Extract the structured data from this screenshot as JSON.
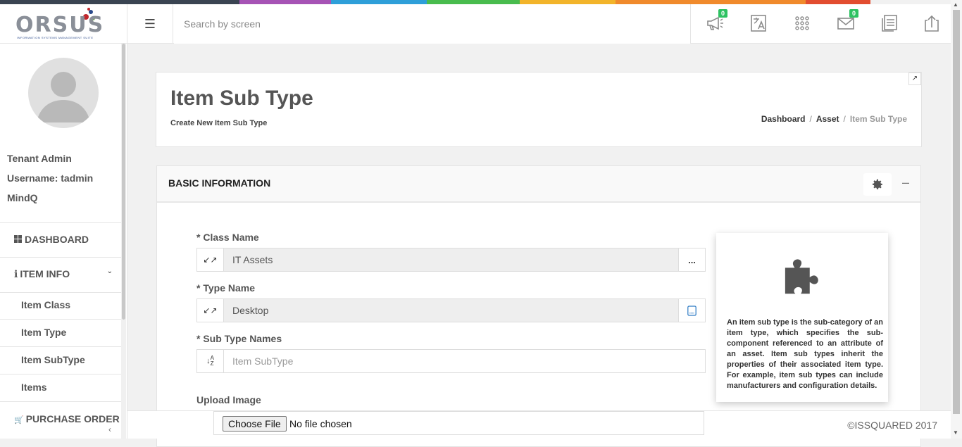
{
  "top_stripe_colors": [
    "#3a4452",
    "#3a4452",
    "#a653b5",
    "#2e9fd9",
    "#49bc4e",
    "#f2b42a",
    "#f08a2c",
    "#e24d30"
  ],
  "header": {
    "logo_text": "ORSUS",
    "logo_subtitle": "INFORMATION SYSTEMS MANAGEMENT SUITE",
    "search_placeholder": "Search by screen",
    "notifications_badge": "0",
    "messages_badge": "0"
  },
  "sidebar": {
    "user_role": "Tenant Admin",
    "username": "Username: tadmin",
    "org": "MindQ",
    "nav": {
      "dashboard": "DASHBOARD",
      "item_info": "ITEM INFO",
      "item_class": "Item Class",
      "item_type": "Item Type",
      "item_subtype": "Item SubType",
      "items": "Items",
      "purchase_order": "PURCHASE ORDER"
    }
  },
  "page": {
    "title": "Item Sub Type",
    "subtitle": "Create New Item Sub Type",
    "breadcrumb": {
      "dashboard": "Dashboard",
      "asset": "Asset",
      "current": "Item Sub Type",
      "separator": "/"
    }
  },
  "form": {
    "section_title": "BASIC INFORMATION",
    "class_name_label": "* Class Name",
    "class_name_value": "IT Assets",
    "class_name_button": "...",
    "type_name_label": "* Type Name",
    "type_name_value": "Desktop",
    "sub_type_label": "* Sub Type Names",
    "sub_type_placeholder": "Item SubType",
    "upload_label": "Upload Image",
    "choose_file": "Choose File",
    "no_file": "No file chosen"
  },
  "info_box": {
    "text": "An item sub type is the sub-category of an item type, which specifies the sub-component referenced to an attribute of an asset. Item sub types inherit the properties of their associated item type. For example, item sub types can include manufacturers and configuration details."
  },
  "footer": {
    "copyright": "©ISSQUARED 2017"
  }
}
